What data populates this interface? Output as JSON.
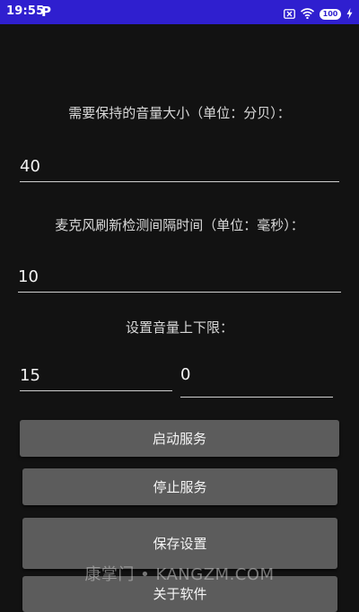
{
  "status_bar": {
    "time": "19:55",
    "app_icon": "P",
    "notification_icon": "close-box-icon",
    "wifi_icon": "wifi-icon",
    "battery": "100",
    "charging_icon": "bolt-icon"
  },
  "form": {
    "target_volume_label": "需要保持的音量大小（单位：分贝）：",
    "target_volume_value": "40",
    "refresh_interval_label": "麦克风刷新检测间隔时间（单位：毫秒）：",
    "refresh_interval_value": "10",
    "range_label": "设置音量上下限：",
    "lower_limit_value": "15",
    "upper_limit_value": "0"
  },
  "buttons": {
    "start": "启动服务",
    "stop": "停止服务",
    "save": "保存设置",
    "about": "关于软件"
  },
  "watermark": "康掌门 • KANGZM.COM",
  "colors": {
    "status_bar": "#2f1fcf",
    "background": "#121212",
    "button": "#5c5c5c"
  }
}
